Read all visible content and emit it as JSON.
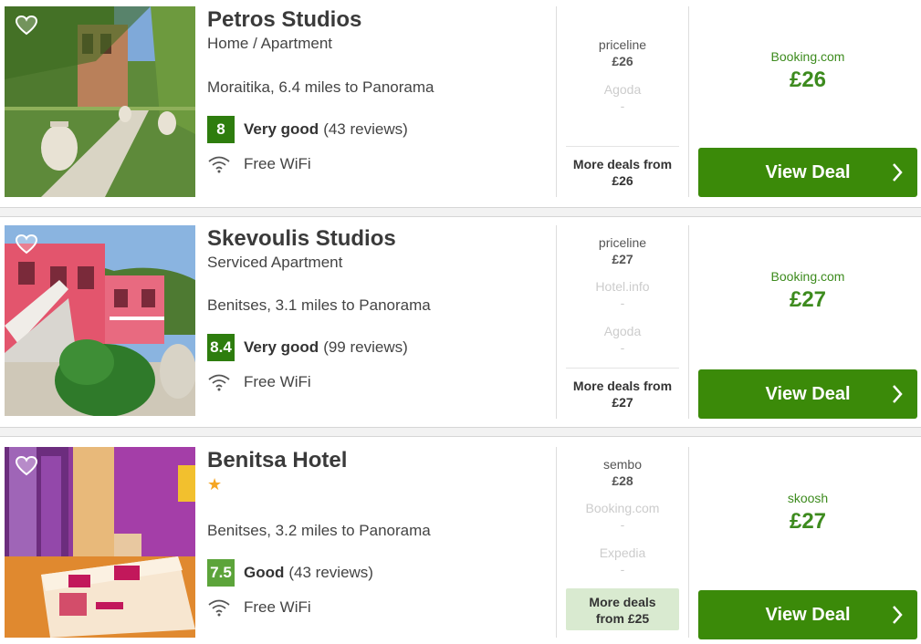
{
  "colors": {
    "score_dark": "#2e7d0e",
    "score_light": "#5ca43a",
    "deal_green": "#3b8a09",
    "price_green": "#3d8b1e",
    "highlight": "#d9ead0"
  },
  "hotels": [
    {
      "name": "Petros Studios",
      "type": "Home / Apartment",
      "location": "Moraitika, 6.4 miles to Panorama",
      "score": "8",
      "rating_label": "Very good",
      "reviews": "(43 reviews)",
      "amenity": "Free WiFi",
      "deals": [
        {
          "provider": "priceline",
          "price": "£26"
        },
        {
          "provider": "Agoda",
          "price": "-"
        }
      ],
      "more_deals_label": "More deals from",
      "more_deals_price": "£26",
      "best_provider": "Booking.com",
      "best_price": "£26",
      "cta": "View Deal"
    },
    {
      "name": "Skevoulis Studios",
      "type": "Serviced Apartment",
      "location": "Benitses, 3.1 miles to Panorama",
      "score": "8.4",
      "rating_label": "Very good",
      "reviews": "(99 reviews)",
      "amenity": "Free WiFi",
      "deals": [
        {
          "provider": "priceline",
          "price": "£27"
        },
        {
          "provider": "Hotel.info",
          "price": "-"
        },
        {
          "provider": "Agoda",
          "price": "-"
        }
      ],
      "more_deals_label": "More deals from",
      "more_deals_price": "£27",
      "best_provider": "Booking.com",
      "best_price": "£27",
      "cta": "View Deal"
    },
    {
      "name": "Benitsa Hotel",
      "stars": "★",
      "location": "Benitses, 3.2 miles to Panorama",
      "score": "7.5",
      "rating_label": "Good",
      "reviews": "(43 reviews)",
      "amenity": "Free WiFi",
      "deals": [
        {
          "provider": "sembo",
          "price": "£28"
        },
        {
          "provider": "Booking.com",
          "price": "-"
        },
        {
          "provider": "Expedia",
          "price": "-"
        }
      ],
      "more_deals_label": "More deals",
      "more_deals_price": "from £25",
      "best_provider": "skoosh",
      "best_price": "£27",
      "cta": "View Deal"
    }
  ]
}
